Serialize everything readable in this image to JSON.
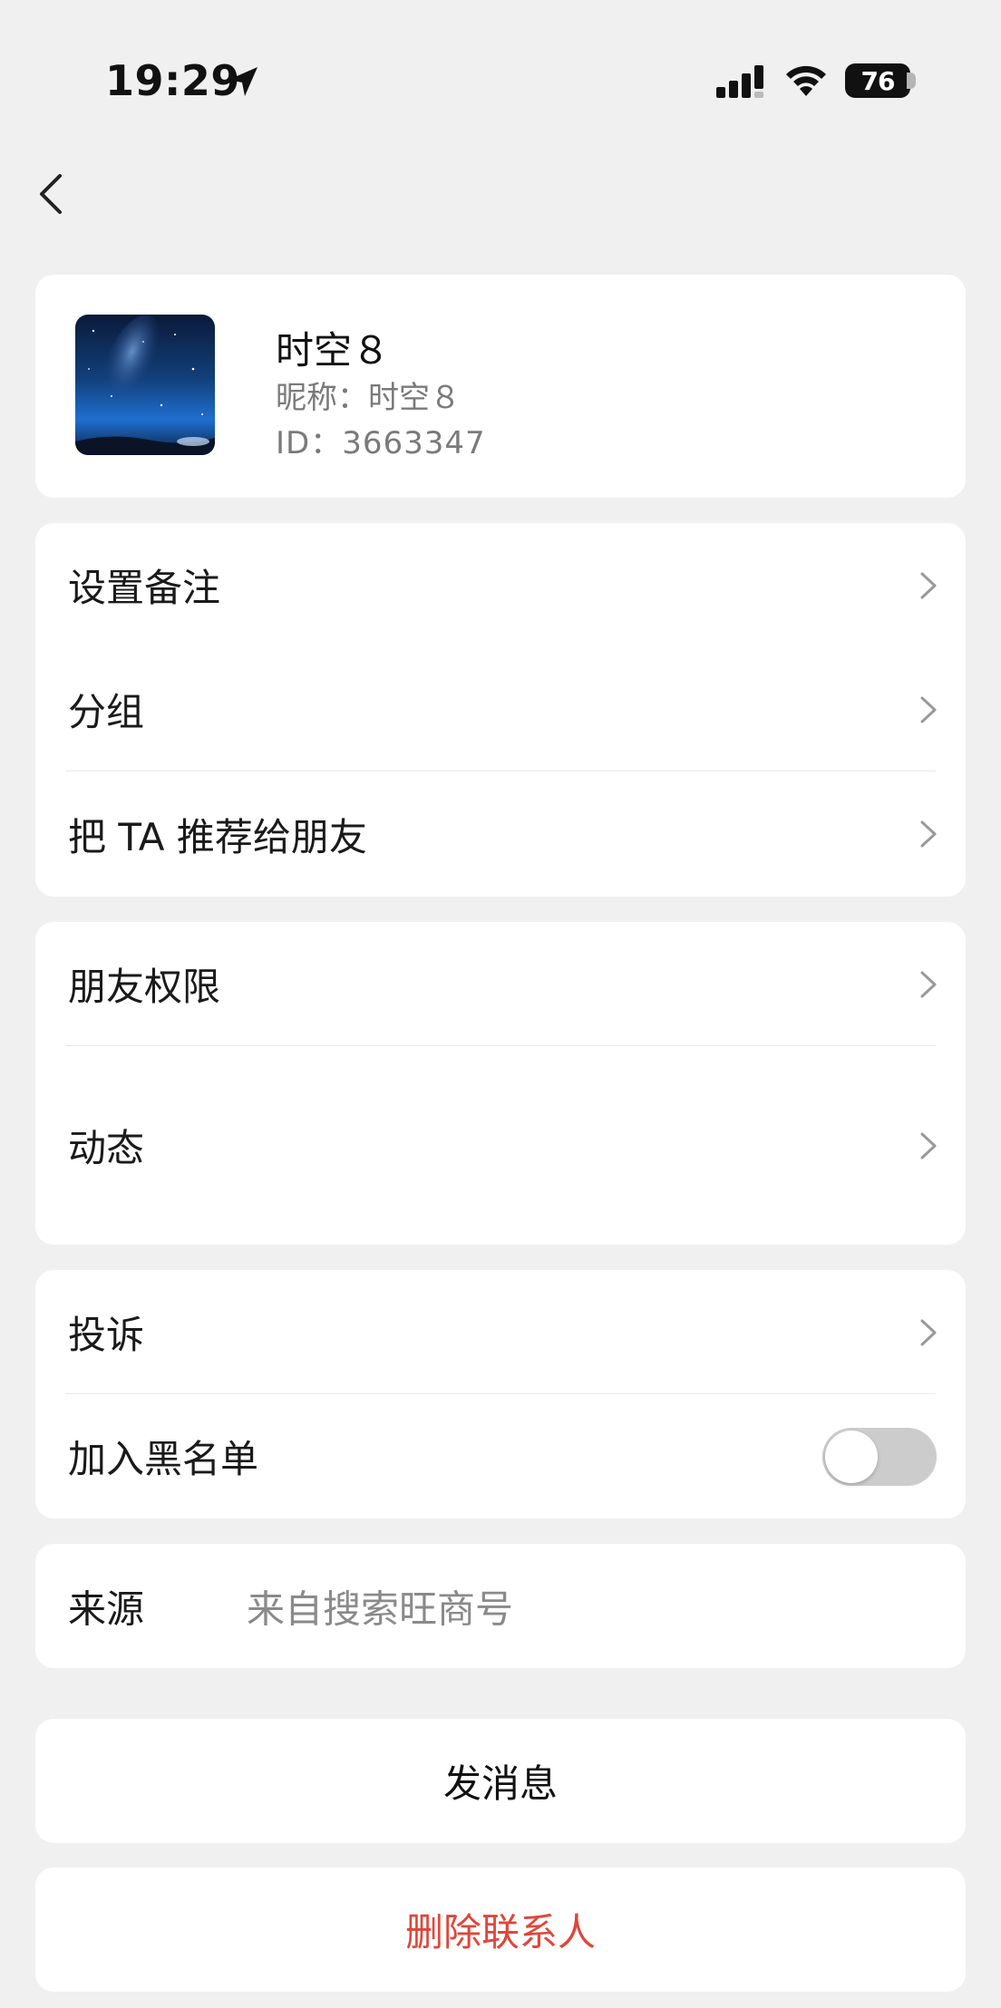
{
  "status_bar": {
    "time": "19:29",
    "battery": "76",
    "icons": [
      "location-arrow-icon",
      "cellular-signal-icon",
      "wifi-icon",
      "battery-icon"
    ]
  },
  "nav": {
    "back_icon": "chevron-left-icon"
  },
  "profile": {
    "name": "时空８",
    "nickname": "昵称：时空８",
    "id": "ID：3663347",
    "avatar": "starry-night-avatar"
  },
  "group1": {
    "items": [
      {
        "label": "设置备注"
      },
      {
        "label": "分组"
      },
      {
        "label": "把 TA 推荐给朋友"
      }
    ]
  },
  "group2": {
    "items": [
      {
        "label": "朋友权限"
      },
      {
        "label": "动态"
      }
    ]
  },
  "group3": {
    "complaint": "投诉",
    "blacklist": {
      "label": "加入黑名单",
      "enabled": false
    }
  },
  "source": {
    "label": "来源",
    "value": "来自搜索旺商号"
  },
  "actions": {
    "send_message": "发消息",
    "delete_contact": "删除联系人"
  },
  "colors": {
    "background": "#f0f0f1",
    "card": "#ffffff",
    "danger": "#e0463a",
    "toggle_off": "#cccccc",
    "secondary_text": "#7a7a7a"
  }
}
